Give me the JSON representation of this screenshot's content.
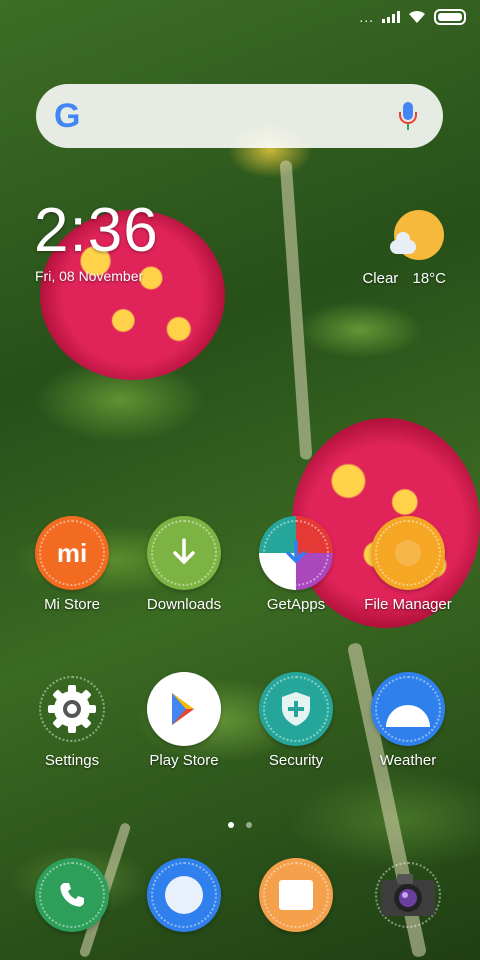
{
  "status_bar": {
    "dots": "..."
  },
  "search": {
    "logo": "G",
    "icon": "mic-icon"
  },
  "clock": {
    "time": "2:36",
    "date": "Fri, 08 November"
  },
  "weather": {
    "condition": "Clear",
    "temperature": "18°C",
    "icon": "partly-sunny-icon"
  },
  "apps": [
    {
      "label": "Mi Store",
      "color": "#f26b21"
    },
    {
      "label": "Downloads",
      "color": "#7cb342"
    },
    {
      "label": "GetApps",
      "color": "#e53935"
    },
    {
      "label": "File Manager",
      "color": "#f5a623"
    },
    {
      "label": "Settings",
      "color": "#555555"
    },
    {
      "label": "Play Store",
      "color": "#ffffff"
    },
    {
      "label": "Security",
      "color": "#26a69a"
    },
    {
      "label": "Weather",
      "color": "#2f80ed"
    }
  ],
  "page_indicator": {
    "pages": 2,
    "active": 1
  },
  "dock": [
    {
      "name": "phone",
      "color": "#2e9e5b"
    },
    {
      "name": "browser",
      "color": "#2f80ed"
    },
    {
      "name": "gallery",
      "color": "#f5a04a"
    },
    {
      "name": "camera",
      "color": "#444444"
    }
  ]
}
